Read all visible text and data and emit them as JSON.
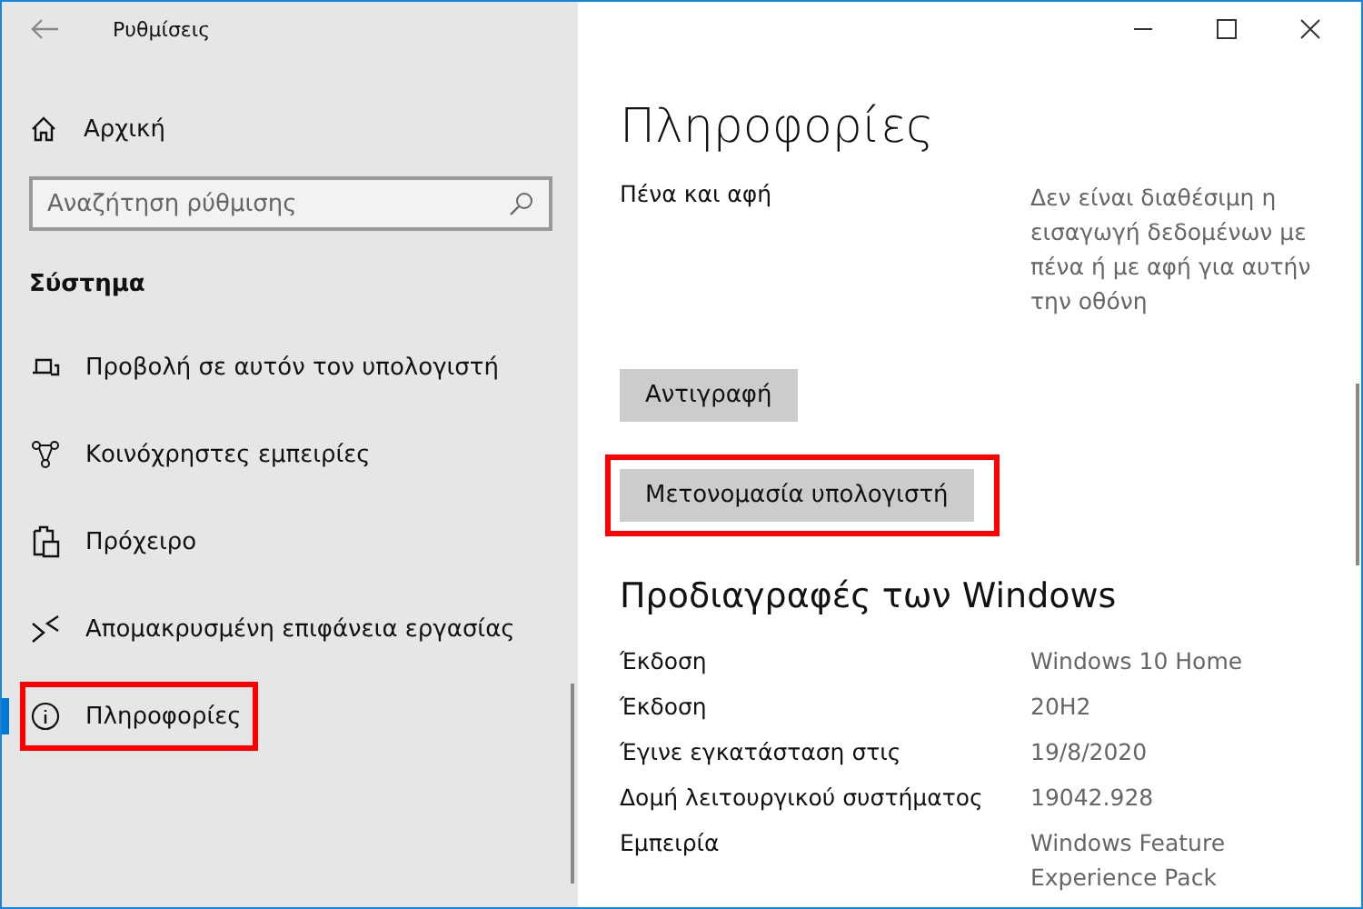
{
  "window": {
    "title": "Ρυθμίσεις"
  },
  "sidebar": {
    "home": "Αρχική",
    "search": {
      "placeholder": "Αναζήτηση ρύθμισης"
    },
    "section": "Σύστημα",
    "items": [
      {
        "kind": "project",
        "label": "Προβολή σε αυτόν τον υπολογιστή",
        "selected": false,
        "highlighted": false
      },
      {
        "kind": "share",
        "label": "Κοινόχρηστες εμπειρίες",
        "selected": false,
        "highlighted": false
      },
      {
        "kind": "clipboard",
        "label": "Πρόχειρο",
        "selected": false,
        "highlighted": false
      },
      {
        "kind": "remote",
        "label": "Απομακρυσμένη επιφάνεια εργασίας",
        "selected": false,
        "highlighted": false
      },
      {
        "kind": "info",
        "label": "Πληροφορίες",
        "selected": true,
        "highlighted": true
      }
    ]
  },
  "content": {
    "title": "Πληροφορίες",
    "device_rows": [
      {
        "label": "Πένα και αφή",
        "value": "Δεν είναι διαθέσιμη η εισαγωγή δεδομένων με πένα ή με αφή για αυτήν την οθόνη"
      }
    ],
    "buttons": [
      {
        "label": "Αντιγραφή",
        "highlighted": false
      },
      {
        "label": "Μετονομασία υπολογιστή",
        "highlighted": true
      }
    ],
    "specs_title": "Προδιαγραφές των Windows",
    "specs": [
      {
        "label": "Έκδοση",
        "value": "Windows 10 Home"
      },
      {
        "label": "Έκδοση",
        "value": "20H2"
      },
      {
        "label": "Έγινε εγκατάσταση στις",
        "value": "19/8/2020"
      },
      {
        "label": "Δομή λειτουργικού συστήματος",
        "value": "19042.928"
      },
      {
        "label": "Εμπειρία",
        "value": "Windows Feature Experience Pack"
      }
    ]
  }
}
